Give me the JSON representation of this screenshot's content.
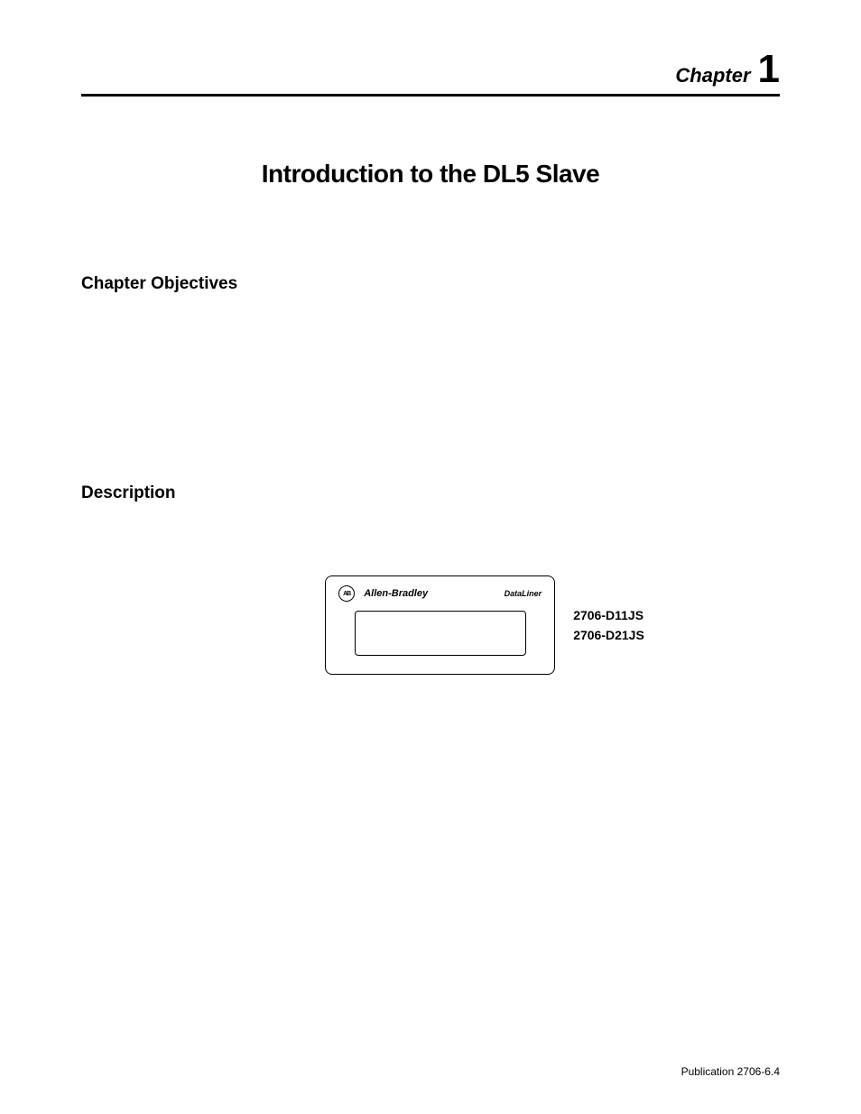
{
  "header": {
    "chapter_label": "Chapter",
    "chapter_number": "1"
  },
  "title": "Introduction to the DL5 Slave",
  "sections": {
    "objectives": "Chapter Objectives",
    "description": "Description"
  },
  "device": {
    "logo_text": "AB",
    "brand": "Allen-Bradley",
    "product_line": "DataLiner",
    "models": [
      "2706-D11JS",
      "2706-D21JS"
    ]
  },
  "footer": {
    "publication": "Publication 2706-6.4"
  }
}
